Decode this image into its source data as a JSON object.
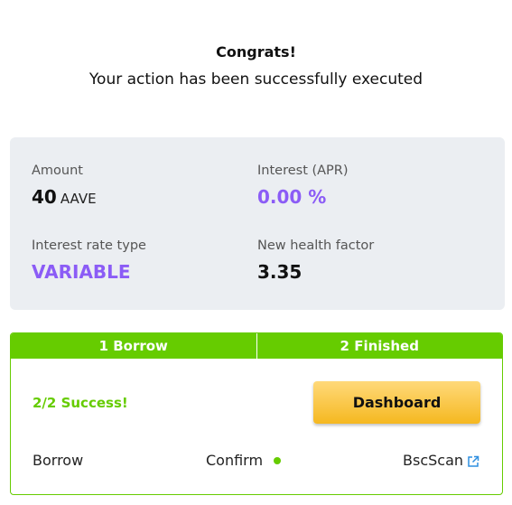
{
  "header": {
    "title": "Congrats!",
    "subtitle": "Your action has been successfully executed"
  },
  "summary": {
    "amount": {
      "label": "Amount",
      "value": "40",
      "unit": "AAVE"
    },
    "interest": {
      "label": "Interest (APR)",
      "value": "0.00 %"
    },
    "rate_type": {
      "label": "Interest rate type",
      "value": "VARIABLE"
    },
    "health_factor": {
      "label": "New health factor",
      "value": "3.35"
    }
  },
  "steps": {
    "items": [
      {
        "label": "1 Borrow"
      },
      {
        "label": "2 Finished"
      }
    ],
    "success_text": "2/2 Success!",
    "dashboard_label": "Dashboard",
    "tx_row": {
      "action": "Borrow",
      "status": "Confirm",
      "explorer": "BscScan"
    }
  },
  "colors": {
    "accent_green": "#66cc00",
    "accent_purple": "#8b5cf6",
    "button_gold": "#f5b820",
    "card_gray": "#ebeef2"
  },
  "icons": {
    "status": "status-dot-icon",
    "explorer": "external-link-icon"
  }
}
